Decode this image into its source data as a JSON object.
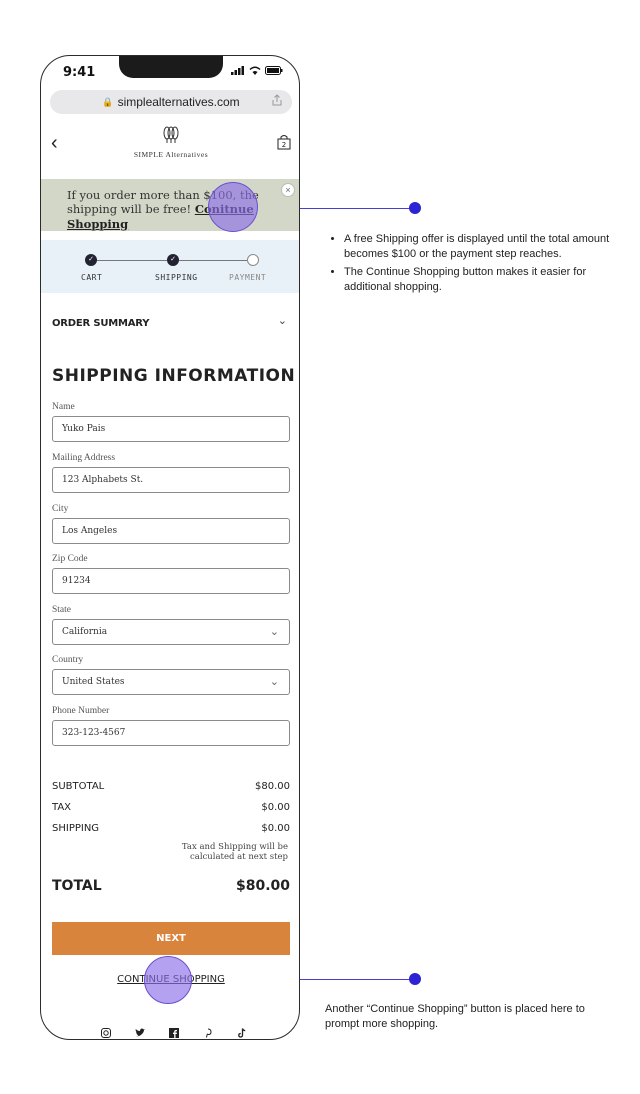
{
  "status_bar": {
    "time": "9:41"
  },
  "browser": {
    "url": "simplealternatives.com"
  },
  "brand": {
    "logo_text": "SIMPLE Alternatives"
  },
  "promo": {
    "text": "If you order more than $100, the shipping will be free!",
    "link": "Conitnue Shopping",
    "close": "×"
  },
  "steps": [
    {
      "label": "CART",
      "state": "done"
    },
    {
      "label": "SHIPPING",
      "state": "done"
    },
    {
      "label": "PAYMENT",
      "state": "pending"
    }
  ],
  "order_summary": {
    "label": "ORDER SUMMARY"
  },
  "shipping": {
    "title": "SHIPPING INFORMATION",
    "fields": [
      {
        "label": "Name",
        "value": "Yuko Pais"
      },
      {
        "label": "Mailing Address",
        "value": "123 Alphabets St."
      },
      {
        "label": "City",
        "value": "Los Angeles"
      },
      {
        "label": "Zip Code",
        "value": "91234"
      },
      {
        "label": "State",
        "value": "California"
      },
      {
        "label": "Country",
        "value": "United States"
      },
      {
        "label": "Phone Number",
        "value": "323-123-4567"
      }
    ]
  },
  "summary": {
    "subtotal_label": "SUBTOTAL",
    "subtotal": "$80.00",
    "tax_label": "TAX",
    "tax": "$0.00",
    "shipping_label": "SHIPPING",
    "shipping": "$0.00",
    "note": "Tax and Shipping will be calculated at next step",
    "total_label": "TOTAL",
    "total": "$80.00"
  },
  "actions": {
    "next": "NEXT",
    "continue_shopping": "CONTINUE SHOPPING"
  },
  "socials": [
    "instagram-icon",
    "twitter-icon",
    "facebook-icon",
    "pinterest-icon",
    "tiktok-icon"
  ],
  "annotations": {
    "note1": [
      "A free Shipping offer is displayed until the total amount becomes $100 or the payment step reaches.",
      "The Continue Shopping button makes it easier for additional shopping."
    ],
    "note2": "Another “Continue Shopping” button is placed here to prompt more shopping."
  },
  "colors": {
    "accent": "#d9843c",
    "promo_bg": "#d3d7c8",
    "steps_bg": "#e9f1f8",
    "callout": "#2d23d4"
  }
}
